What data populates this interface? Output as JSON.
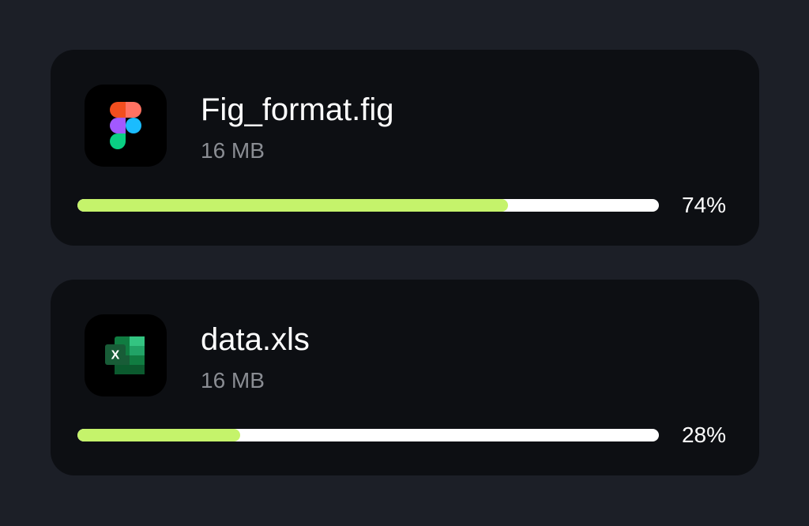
{
  "files": [
    {
      "name": "Fig_format.fig",
      "size": "16 MB",
      "icon": "figma-icon",
      "progress": 0.74,
      "progress_label": "74%"
    },
    {
      "name": "data.xls",
      "size": "16 MB",
      "icon": "excel-icon",
      "progress": 0.28,
      "progress_label": "28%"
    }
  ],
  "colors": {
    "background": "#1c1f27",
    "card": "#0d0f13",
    "progress_fill": "#c5f36b",
    "progress_track": "#ffffff",
    "text_primary": "#ffffff",
    "text_secondary": "#8a8d93"
  }
}
